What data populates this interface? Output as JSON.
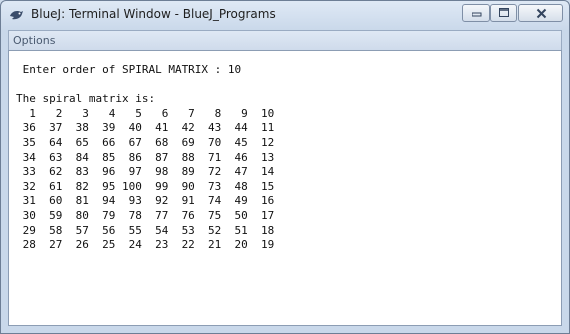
{
  "window": {
    "title": "BlueJ: Terminal Window - BlueJ_Programs",
    "icons": {
      "app": "bluej-bird-icon",
      "minimize": "minimize-icon",
      "maximize": "maximize-icon",
      "close": "close-icon"
    }
  },
  "menu": {
    "options_label": "Options"
  },
  "terminal": {
    "lines": [
      " Enter order of SPIRAL MATRIX : 10",
      "",
      "The spiral matrix is:",
      "  1   2   3   4   5   6   7   8   9  10",
      " 36  37  38  39  40  41  42  43  44  11",
      " 35  64  65  66  67  68  69  70  45  12",
      " 34  63  84  85  86  87  88  71  46  13",
      " 33  62  83  96  97  98  89  72  47  14",
      " 32  61  82  95 100  99  90  73  48  15",
      " 31  60  81  94  93  92  91  74  49  16",
      " 30  59  80  79  78  77  76  75  50  17",
      " 29  58  57  56  55  54  53  52  51  18",
      " 28  27  26  25  24  23  22  21  20  19"
    ]
  }
}
